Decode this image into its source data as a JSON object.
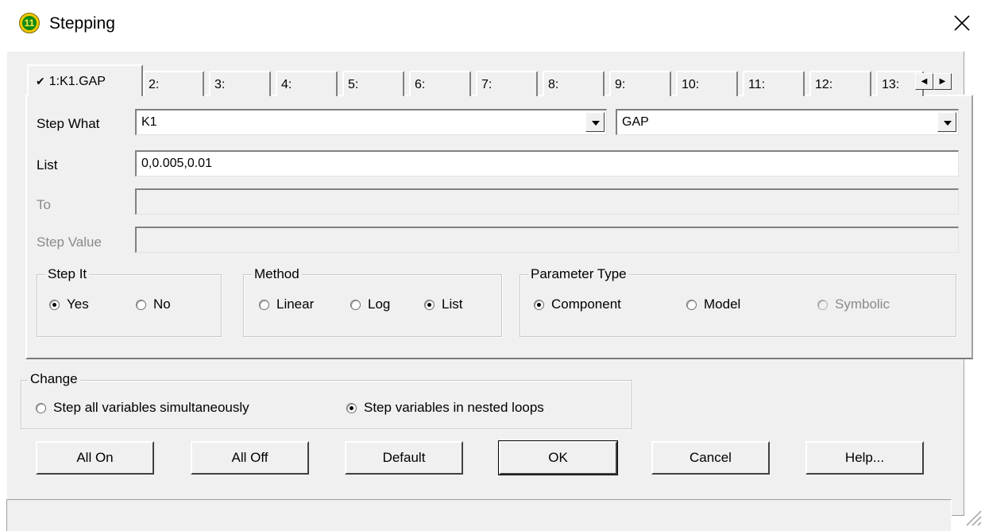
{
  "window": {
    "title": "Stepping",
    "app_icon_text": "11"
  },
  "tabs": [
    {
      "label": "1:K1.GAP",
      "checked": true
    },
    {
      "label": "2:"
    },
    {
      "label": "3:"
    },
    {
      "label": "4:"
    },
    {
      "label": "5:"
    },
    {
      "label": "6:"
    },
    {
      "label": "7:"
    },
    {
      "label": "8:"
    },
    {
      "label": "9:"
    },
    {
      "label": "10:"
    },
    {
      "label": "11:"
    },
    {
      "label": "12:"
    },
    {
      "label": "13:"
    }
  ],
  "form": {
    "step_what_label": "Step What",
    "step_what_component": "K1",
    "step_what_parameter": "GAP",
    "list_label": "List",
    "list_value": "0,0.005,0.01",
    "to_label": "To",
    "to_value": "",
    "step_value_label": "Step Value",
    "step_value_value": ""
  },
  "step_it": {
    "legend": "Step It",
    "yes": "Yes",
    "no": "No",
    "selected": "yes"
  },
  "method": {
    "legend": "Method",
    "linear": "Linear",
    "log": "Log",
    "list": "List",
    "selected": "list"
  },
  "parameter_type": {
    "legend": "Parameter Type",
    "component": "Component",
    "model": "Model",
    "symbolic": "Symbolic",
    "selected": "component"
  },
  "change": {
    "legend": "Change",
    "simultaneous": "Step all variables simultaneously",
    "nested": "Step variables in nested loops",
    "selected": "nested"
  },
  "buttons": {
    "all_on": "All On",
    "all_off": "All Off",
    "default": "Default",
    "ok": "OK",
    "cancel": "Cancel",
    "help": "Help..."
  },
  "colors": {
    "face": "#f0f0f0",
    "window": "#ffffff",
    "disabled_text": "#8a8a8a"
  }
}
